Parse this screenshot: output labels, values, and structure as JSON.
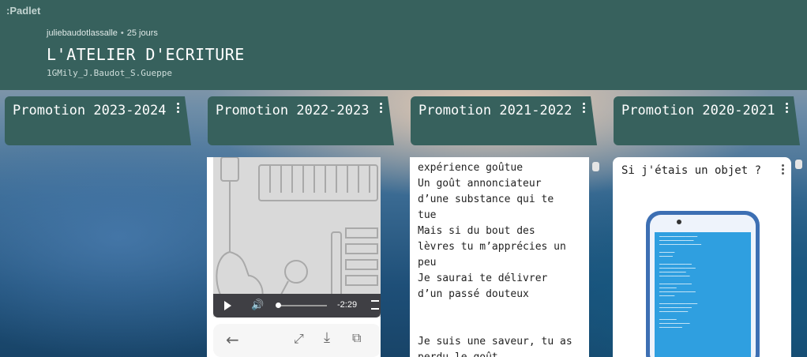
{
  "app": {
    "logo": ":Padlet"
  },
  "header": {
    "author": "juliebaudotlassalle",
    "age": "25 jours",
    "title": "L'ATELIER D'ECRITURE",
    "subtitle": "1GMily_J.Baudot_S.Gueppe"
  },
  "columns": [
    {
      "title": "Promotion 2023-2024"
    },
    {
      "title": "Promotion 2022-2023"
    },
    {
      "title": "Promotion 2021-2022"
    },
    {
      "title": "Promotion 2020-2021"
    }
  ],
  "audio_card": {
    "time": "-2:29",
    "progress": 0.02
  },
  "text_card": {
    "lines": [
      "expérience goûtue",
      "Un goût annonciateur",
      "d’une substance qui te",
      "tue",
      "Mais si du bout des",
      "lèvres tu m’apprécies un",
      "peu",
      "Je saurai te délivrer",
      "d’un passé douteux",
      "",
      "",
      "Je suis une saveur, tu as",
      "perdu le goût"
    ]
  },
  "object_card": {
    "title": "Si j'étais un objet ?"
  },
  "icons": {
    "play": "play-icon",
    "volume": "volume-icon",
    "fullscreen": "fullscreen-icon",
    "back": "arrow-left-icon",
    "expand": "expand-icon",
    "download": "download-icon",
    "open": "external-link-icon"
  }
}
